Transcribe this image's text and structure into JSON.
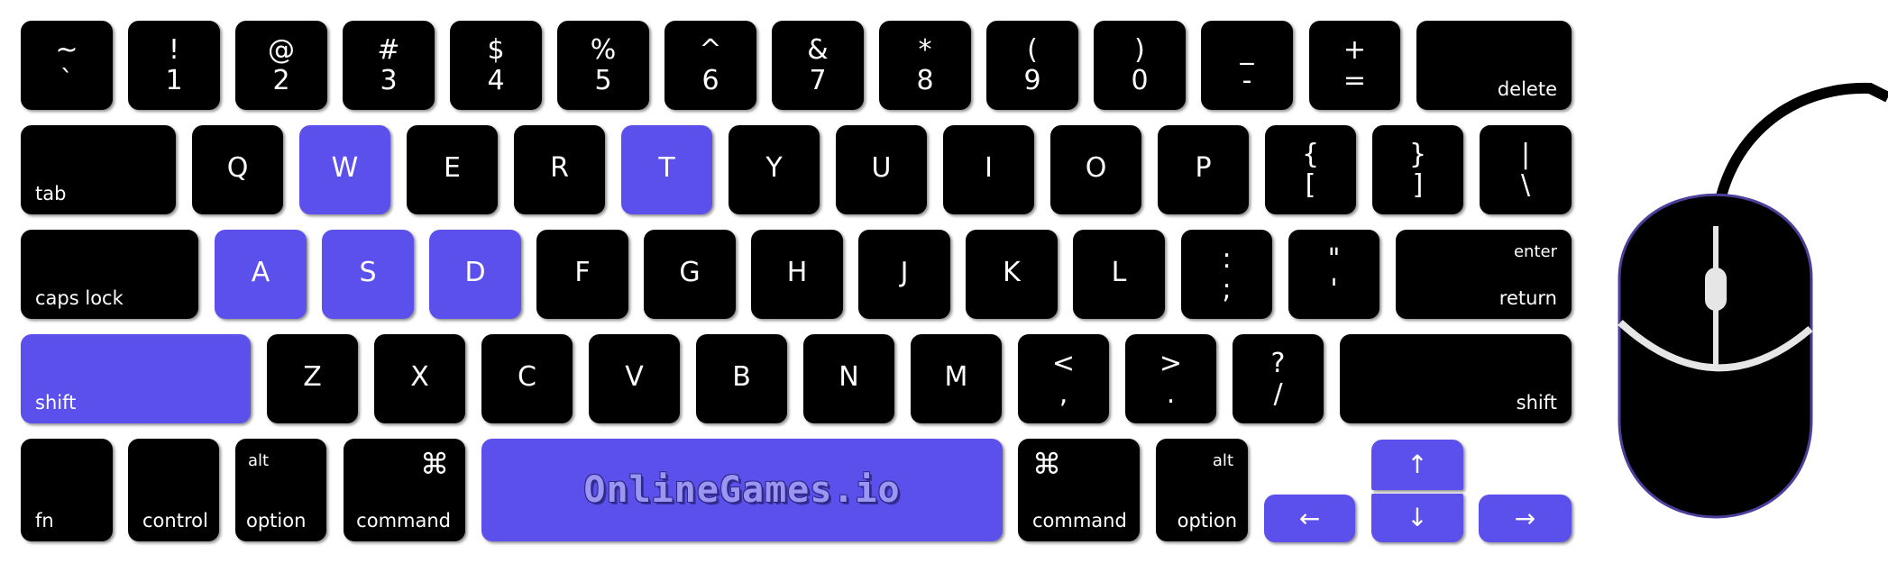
{
  "colors": {
    "key": "#000000",
    "highlight": "#5b50ec",
    "legend": "#ffffff",
    "mouse_outline": "#4a3f9a",
    "mouse_detail": "#e6e6e6"
  },
  "keyboard": {
    "row1": [
      {
        "top": "~",
        "bottom": "`"
      },
      {
        "top": "!",
        "bottom": "1"
      },
      {
        "top": "@",
        "bottom": "2"
      },
      {
        "top": "#",
        "bottom": "3"
      },
      {
        "top": "$",
        "bottom": "4"
      },
      {
        "top": "%",
        "bottom": "5"
      },
      {
        "top": "^",
        "bottom": "6"
      },
      {
        "top": "&",
        "bottom": "7"
      },
      {
        "top": "*",
        "bottom": "8"
      },
      {
        "top": "(",
        "bottom": "9"
      },
      {
        "top": ")",
        "bottom": "0"
      },
      {
        "top": "_",
        "bottom": "-"
      },
      {
        "top": "+",
        "bottom": "="
      },
      {
        "label": "delete"
      }
    ],
    "row2": [
      {
        "label": "tab"
      },
      {
        "char": "Q"
      },
      {
        "char": "W",
        "highlighted": true
      },
      {
        "char": "E"
      },
      {
        "char": "R"
      },
      {
        "char": "T",
        "highlighted": true
      },
      {
        "char": "Y"
      },
      {
        "char": "U"
      },
      {
        "char": "I"
      },
      {
        "char": "O"
      },
      {
        "char": "P"
      },
      {
        "top": "{",
        "bottom": "["
      },
      {
        "top": "}",
        "bottom": "]"
      },
      {
        "top": "|",
        "bottom": "\\"
      }
    ],
    "row3": [
      {
        "label": "caps lock"
      },
      {
        "char": "A",
        "highlighted": true
      },
      {
        "char": "S",
        "highlighted": true
      },
      {
        "char": "D",
        "highlighted": true
      },
      {
        "char": "F"
      },
      {
        "char": "G"
      },
      {
        "char": "H"
      },
      {
        "char": "J"
      },
      {
        "char": "K"
      },
      {
        "char": "L"
      },
      {
        "top": ":",
        "bottom": ";"
      },
      {
        "top": "\"",
        "bottom": "'"
      },
      {
        "top_label": "enter",
        "label": "return"
      }
    ],
    "row4": [
      {
        "label": "shift",
        "highlighted": true
      },
      {
        "char": "Z"
      },
      {
        "char": "X"
      },
      {
        "char": "C"
      },
      {
        "char": "V"
      },
      {
        "char": "B"
      },
      {
        "char": "N"
      },
      {
        "char": "M"
      },
      {
        "top": "<",
        "bottom": ","
      },
      {
        "top": ">",
        "bottom": "."
      },
      {
        "top": "?",
        "bottom": "/"
      },
      {
        "label": "shift"
      }
    ],
    "row5": {
      "fn": "fn",
      "control": "control",
      "left_option": {
        "alt": "alt",
        "label": "option"
      },
      "left_command": {
        "symbol": "⌘",
        "label": "command"
      },
      "space_logo": "OnlineGames.io",
      "right_command": {
        "symbol": "⌘",
        "label": "command"
      },
      "right_option": {
        "alt": "alt",
        "label": "option"
      },
      "arrows": {
        "up": "↑",
        "down": "↓",
        "left": "←",
        "right": "→",
        "highlighted": true
      }
    }
  },
  "mouse": {
    "icon": "mouse-icon"
  }
}
